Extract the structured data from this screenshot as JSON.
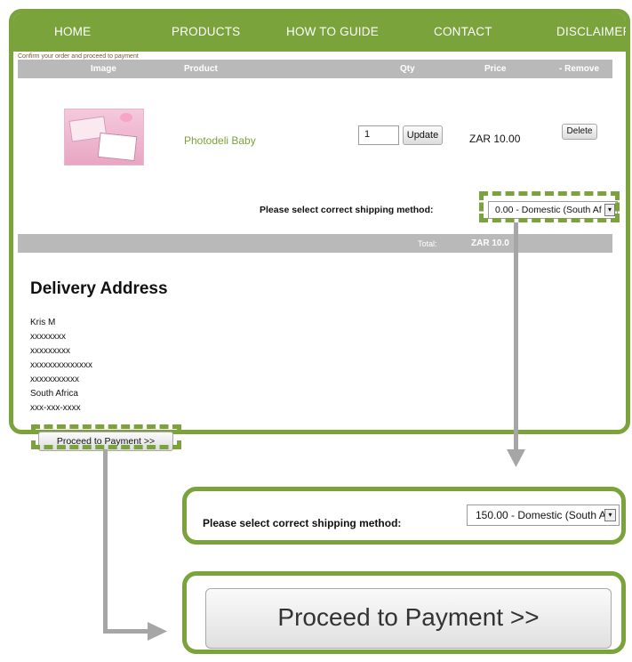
{
  "nav": {
    "items": [
      "HOME",
      "PRODUCTS",
      "HOW TO GUIDE",
      "CONTACT",
      "DISCLAIMER"
    ]
  },
  "confirm_text": "Confirm your order and proceed to payment",
  "table": {
    "headers": [
      "Image",
      "Product",
      "Qty",
      "Price",
      "- Remove"
    ],
    "row": {
      "product": "Photodeli Baby",
      "qty": "1",
      "update_label": "Update",
      "price": "ZAR 10.00",
      "delete_label": "Delete"
    }
  },
  "shipping": {
    "label": "Please select correct shipping method:",
    "selected": "0.00 - Domestic (South Af",
    "arrow": "▾"
  },
  "total": {
    "label": "Total:",
    "value": "ZAR 10.0"
  },
  "delivery": {
    "title": "Delivery Address",
    "lines": [
      "Kris M",
      "xxxxxxxx",
      "xxxxxxxxx",
      "xxxxxxxxxxxxxx",
      "xxxxxxxxxxx",
      "South Africa",
      "xxx-xxx-xxxx"
    ]
  },
  "proceed_label": "Proceed to Payment >>",
  "zoom_shipping": {
    "label": "Please select correct shipping method:",
    "selected": "150.00 - Domestic (South A"
  },
  "zoom_proceed_label": "Proceed to Payment >>",
  "colors": {
    "brand_green": "#7aa33b",
    "header_gray": "#b9b9b9",
    "connector_gray": "#a6a6a6"
  }
}
